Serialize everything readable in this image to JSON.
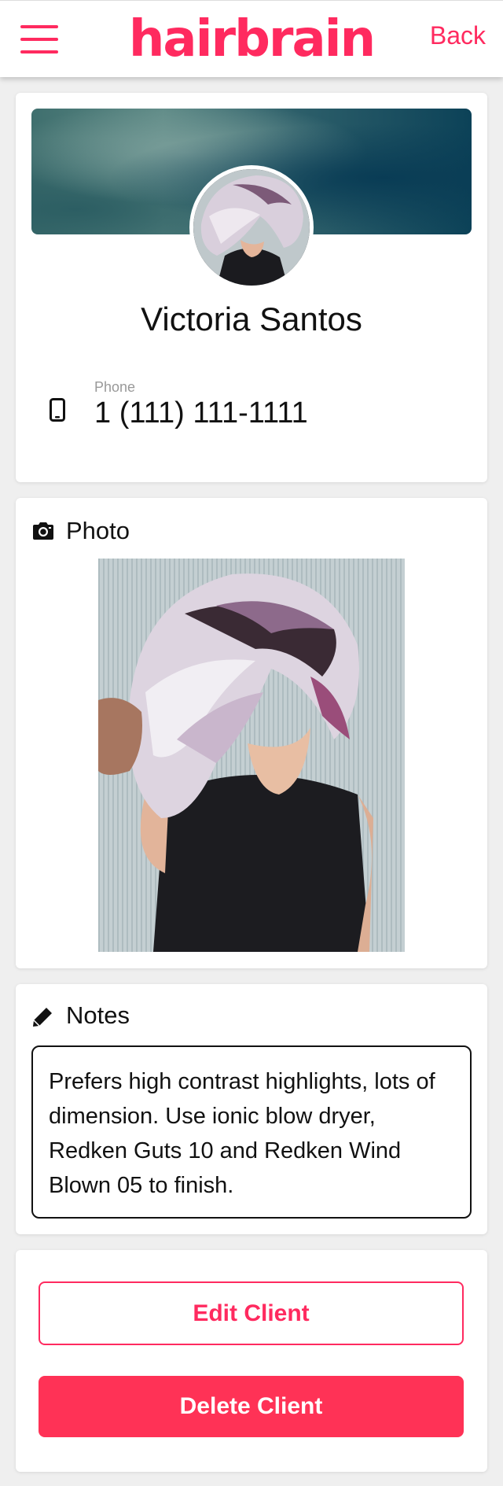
{
  "header": {
    "logo_text": "hairbrain",
    "back_label": "Back",
    "menu_icon": "hamburger-menu-icon",
    "brand_color": "#ff2a5f"
  },
  "client": {
    "name": "Victoria Santos",
    "phone_label": "Phone",
    "phone_value": "1 (111) 111-1111",
    "phone_icon": "mobile-phone-icon"
  },
  "photo_section": {
    "title": "Photo",
    "icon": "camera-icon"
  },
  "notes_section": {
    "title": "Notes",
    "icon": "pencil-icon",
    "text": "Prefers high contrast highlights, lots of dimension. Use ionic blow dryer, Redken Guts 10 and Redken Wind Blown 05 to finish."
  },
  "actions": {
    "edit_label": "Edit Client",
    "delete_label": "Delete Client",
    "delete_color": "#ff3256"
  }
}
